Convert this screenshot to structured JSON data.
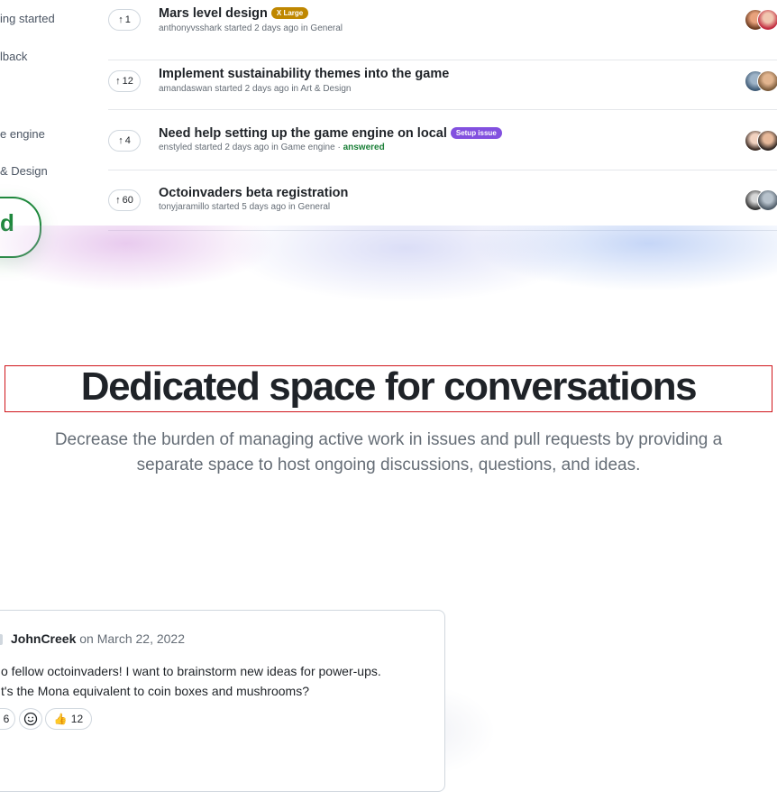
{
  "sidebar": {
    "items": [
      {
        "label": "ing started"
      },
      {
        "label": "lback"
      },
      {
        "label": "e engine"
      },
      {
        "label": "& Design"
      }
    ],
    "feature_button": {
      "label": "d"
    }
  },
  "discussions": [
    {
      "votes": "1",
      "title": "Mars level design",
      "badge": "X Large",
      "badge_color": "#bf8700",
      "meta": "anthonyvsshark started 2 days ago in General",
      "answered": ""
    },
    {
      "votes": "12",
      "title": "Implement sustainability themes into the game",
      "badge": "",
      "badge_color": "",
      "meta": "amandaswan started 2 days ago in Art & Design",
      "answered": ""
    },
    {
      "votes": "4",
      "title": "Need help setting up the game engine on local",
      "badge": "Setup issue",
      "badge_color": "#8250df",
      "meta": "enstyled started 2 days ago in Game engine",
      "answered": "answered"
    },
    {
      "votes": "60",
      "title": "Octoinvaders beta registration",
      "badge": "",
      "badge_color": "",
      "meta": "tonyjaramillo started 5 days ago in General",
      "answered": ""
    }
  ],
  "section": {
    "heading": "Dedicated space for conversations",
    "subheading": "Decrease the burden of managing active work in issues and pull requests by providing a separate space to host ongoing discussions, questions, and ideas."
  },
  "comment": {
    "author": "JohnCreek",
    "date": "on March 22, 2022",
    "line1": "o fellow octoinvaders! I want to brainstorm new ideas for power-ups.",
    "line2": "t's the Mona equivalent to coin boxes and mushrooms?",
    "reactions": [
      {
        "icon": "",
        "count": "6"
      },
      {
        "icon": "smiley-icon",
        "count": ""
      },
      {
        "icon": "👍",
        "count": "12"
      }
    ]
  },
  "colors": {
    "accent_green": "#1f883d",
    "answered_green": "#1a7f37",
    "highlight_red": "#d0151b"
  }
}
